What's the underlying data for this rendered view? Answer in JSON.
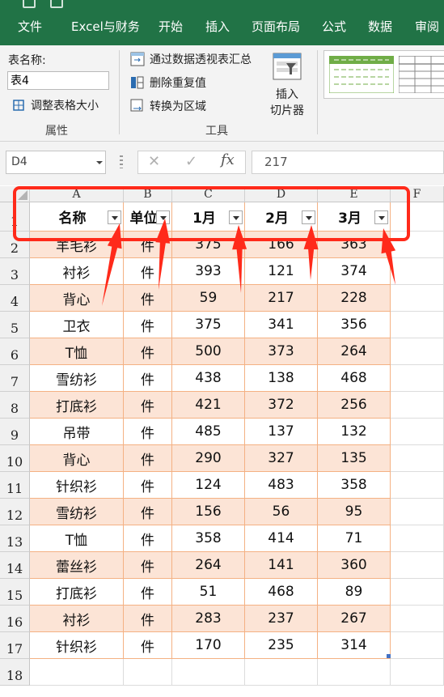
{
  "ribbon": {
    "tabs": [
      "文件",
      "Excel与财务",
      "开始",
      "插入",
      "页面布局",
      "公式",
      "数据",
      "审阅"
    ],
    "table_name_label": "表名称:",
    "table_name_value": "表4",
    "resize_table": "调整表格大小",
    "group_properties": "属性",
    "summarize_pivot": "通过数据透视表汇总",
    "remove_duplicates": "删除重复值",
    "convert_to_range": "转换为区域",
    "insert_slicer_line1": "插入",
    "insert_slicer_line2": "切片器",
    "group_tools": "工具"
  },
  "formula_bar": {
    "name_box": "D4",
    "cancel_symbol": "✕",
    "enter_symbol": "✓",
    "fx_symbol": "fx",
    "value": "217"
  },
  "sheet": {
    "columns": [
      "A",
      "B",
      "C",
      "D",
      "E",
      "F"
    ],
    "row_numbers": [
      "1",
      "2",
      "3",
      "4",
      "5",
      "6",
      "7",
      "8",
      "9",
      "10",
      "11",
      "12",
      "13",
      "14",
      "15",
      "16",
      "17",
      "18"
    ],
    "headers": [
      "名称",
      "单位",
      "1月",
      "2月",
      "3月"
    ],
    "rows": [
      [
        "羊毛衫",
        "件",
        "375",
        "166",
        "363"
      ],
      [
        "衬衫",
        "件",
        "393",
        "121",
        "374"
      ],
      [
        "背心",
        "件",
        "59",
        "217",
        "228"
      ],
      [
        "卫衣",
        "件",
        "375",
        "341",
        "356"
      ],
      [
        "T恤",
        "件",
        "500",
        "373",
        "264"
      ],
      [
        "雪纺衫",
        "件",
        "438",
        "138",
        "468"
      ],
      [
        "打底衫",
        "件",
        "421",
        "372",
        "256"
      ],
      [
        "吊带",
        "件",
        "485",
        "137",
        "132"
      ],
      [
        "背心",
        "件",
        "290",
        "327",
        "135"
      ],
      [
        "针织衫",
        "件",
        "124",
        "483",
        "358"
      ],
      [
        "雪纺衫",
        "件",
        "156",
        "56",
        "95"
      ],
      [
        "T恤",
        "件",
        "358",
        "414",
        "71"
      ],
      [
        "蕾丝衫",
        "件",
        "264",
        "141",
        "360"
      ],
      [
        "打底衫",
        "件",
        "51",
        "468",
        "89"
      ],
      [
        "衬衫",
        "件",
        "283",
        "237",
        "267"
      ],
      [
        "针织衫",
        "件",
        "170",
        "235",
        "314"
      ]
    ],
    "selected_cell": "D4"
  },
  "colors": {
    "ribbon_green": "#217346",
    "band_fill": "#fce4d6",
    "table_border": "#f4b183",
    "annotation_red": "#ff2a1a"
  }
}
